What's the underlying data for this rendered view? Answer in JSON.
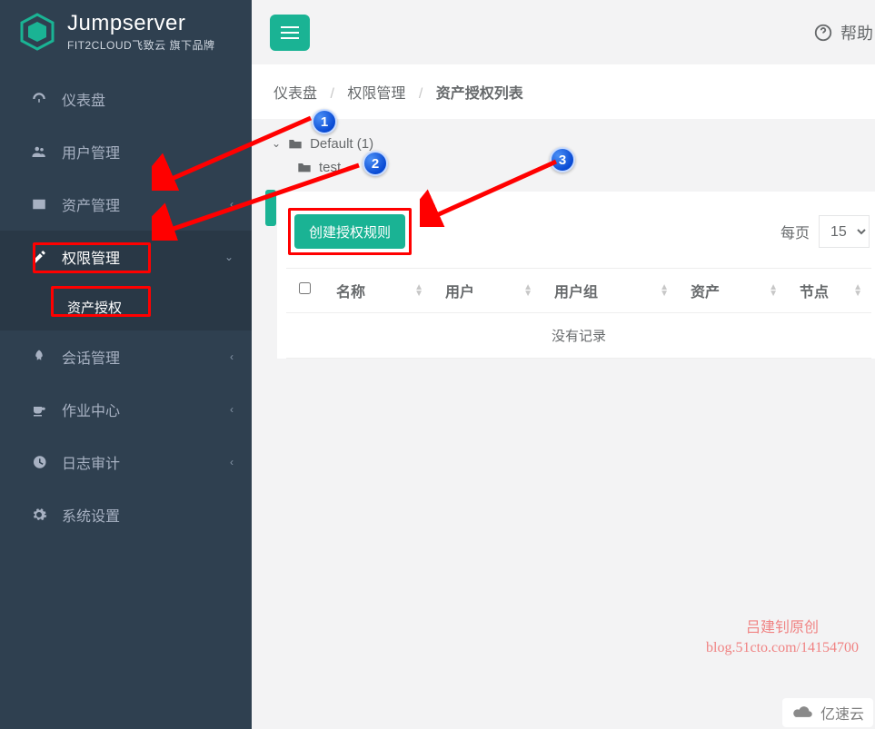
{
  "brand": {
    "name": "Jumpserver",
    "tagline": "FIT2CLOUD飞致云 旗下品牌"
  },
  "sidebar": {
    "items": [
      {
        "label": "仪表盘",
        "has_children": false,
        "active": false
      },
      {
        "label": "用户管理",
        "has_children": true,
        "active": false
      },
      {
        "label": "资产管理",
        "has_children": true,
        "active": false
      },
      {
        "label": "权限管理",
        "has_children": true,
        "active": true,
        "children": [
          {
            "label": "资产授权",
            "active": true
          }
        ]
      },
      {
        "label": "会话管理",
        "has_children": true,
        "active": false
      },
      {
        "label": "作业中心",
        "has_children": true,
        "active": false
      },
      {
        "label": "日志审计",
        "has_children": true,
        "active": false
      },
      {
        "label": "系统设置",
        "has_children": false,
        "active": false
      }
    ]
  },
  "header": {
    "help_label": "帮助"
  },
  "breadcrumb": {
    "root": "仪表盘",
    "section": "权限管理",
    "current": "资产授权列表"
  },
  "tree": {
    "root": "Default (1)",
    "child": "test"
  },
  "content": {
    "create_btn": "创建授权规则",
    "per_page_label": "每页",
    "per_page_value": "15",
    "columns": [
      "名称",
      "用户",
      "用户组",
      "资产",
      "节点"
    ],
    "empty_text": "没有记录"
  },
  "annotations": {
    "b1": "1",
    "b2": "2",
    "b3": "3"
  },
  "watermark": {
    "line1": "吕建钊原创",
    "line2": "blog.51cto.com/14154700",
    "corner": "亿速云"
  }
}
